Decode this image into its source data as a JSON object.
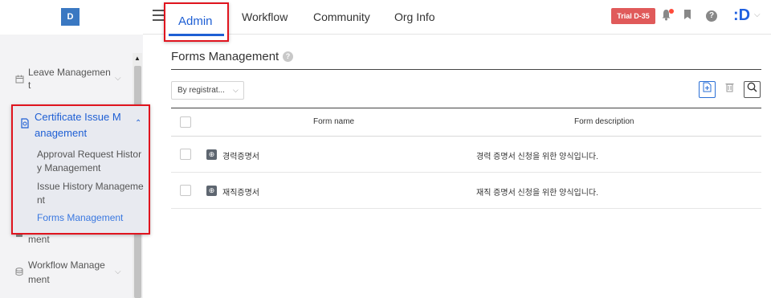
{
  "app": {
    "logo_text": "D"
  },
  "topnav": {
    "tabs": [
      {
        "label": "Admin",
        "active": true
      },
      {
        "label": "Workflow"
      },
      {
        "label": "Community"
      },
      {
        "label": "Org Info"
      }
    ],
    "trial_badge": "Trial D-35",
    "user_mark": ":D"
  },
  "sidebar": {
    "items": [
      {
        "label_line1": "Leave Managemen",
        "label_line2": "t",
        "icon": "calendar-icon"
      },
      {
        "label_line1": "Certificate Issue M",
        "label_line2": "anagement",
        "icon": "certificate-icon",
        "expanded": true
      },
      {
        "label_line1": "",
        "label_line2": "ment",
        "icon": "document-icon"
      },
      {
        "label_line1": "Workflow Manage",
        "label_line2": "ment",
        "icon": "database-icon"
      }
    ],
    "sub_items": [
      {
        "label_line1": "Approval Request Histor",
        "label_line2": "y Management"
      },
      {
        "label_line1": "Issue History Manageme",
        "label_line2": "nt"
      },
      {
        "label_line1": "Forms Management",
        "label_line2": "",
        "active": true
      }
    ]
  },
  "main": {
    "title": "Forms Management",
    "filter": {
      "selected": "By registrat..."
    },
    "table": {
      "columns": [
        "Form name",
        "Form description"
      ],
      "rows": [
        {
          "name": "경력증명서",
          "description": "경력 증명서 신청을 위한 양식입니다."
        },
        {
          "name": "재직증명서",
          "description": "재직 증명서 신청을 위한 양식입니다."
        }
      ]
    }
  },
  "colors": {
    "accent": "#1e5fd4",
    "highlight_border": "#e0141e",
    "trial_badge": "#e05a5a",
    "logo": "#3a78c2"
  }
}
